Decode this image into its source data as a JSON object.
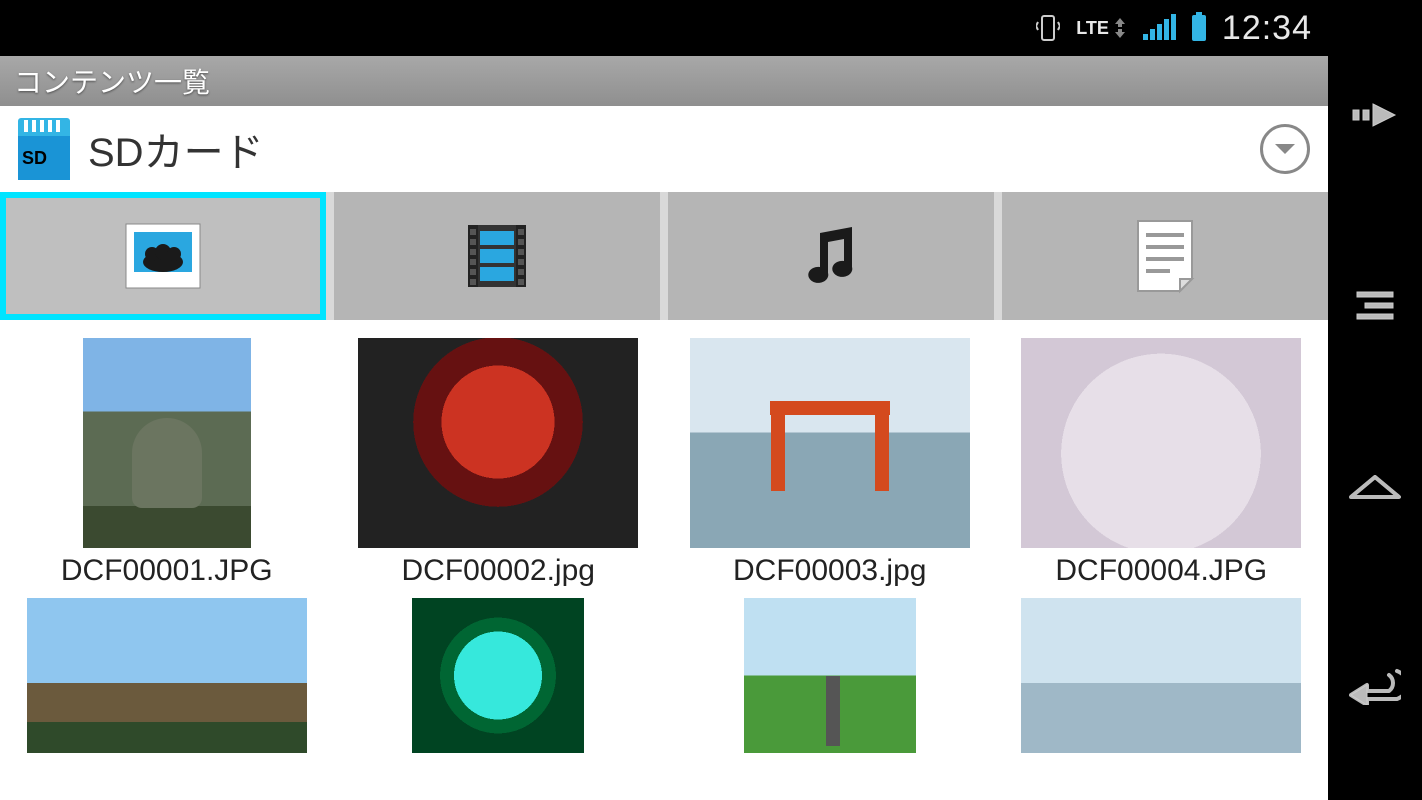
{
  "statusbar": {
    "network_label": "LTE",
    "clock": "12:34"
  },
  "titlebar": {
    "title": "コンテンツ一覧"
  },
  "location": {
    "sd_abbrev": "SD",
    "title": "SDカード"
  },
  "tabs": {
    "items": [
      {
        "name": "photos",
        "active": true
      },
      {
        "name": "videos",
        "active": false
      },
      {
        "name": "music",
        "active": false
      },
      {
        "name": "docs",
        "active": false
      }
    ]
  },
  "files": [
    {
      "name": "DCF00001.JPG"
    },
    {
      "name": "DCF00002.jpg"
    },
    {
      "name": "DCF00003.jpg"
    },
    {
      "name": "DCF00004.JPG"
    }
  ]
}
